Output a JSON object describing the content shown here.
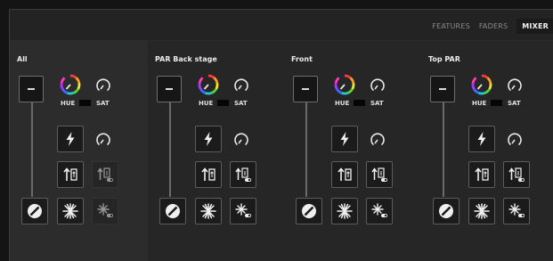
{
  "tabs": [
    {
      "label": "FEATURES",
      "active": false
    },
    {
      "label": "FADERS",
      "active": false
    },
    {
      "label": "MIXER",
      "active": true
    }
  ],
  "labels": {
    "hue": "HUE",
    "sat": "SAT"
  },
  "groups": [
    {
      "title": "All",
      "dim_secondary": true
    },
    {
      "title": "PAR Back stage",
      "dim_secondary": false
    },
    {
      "title": "Front",
      "dim_secondary": false
    },
    {
      "title": "Top PAR",
      "dim_secondary": false
    }
  ],
  "colors": {
    "background": "#262626",
    "active_tab": "#f2f2f2",
    "swatch": "#060606"
  }
}
